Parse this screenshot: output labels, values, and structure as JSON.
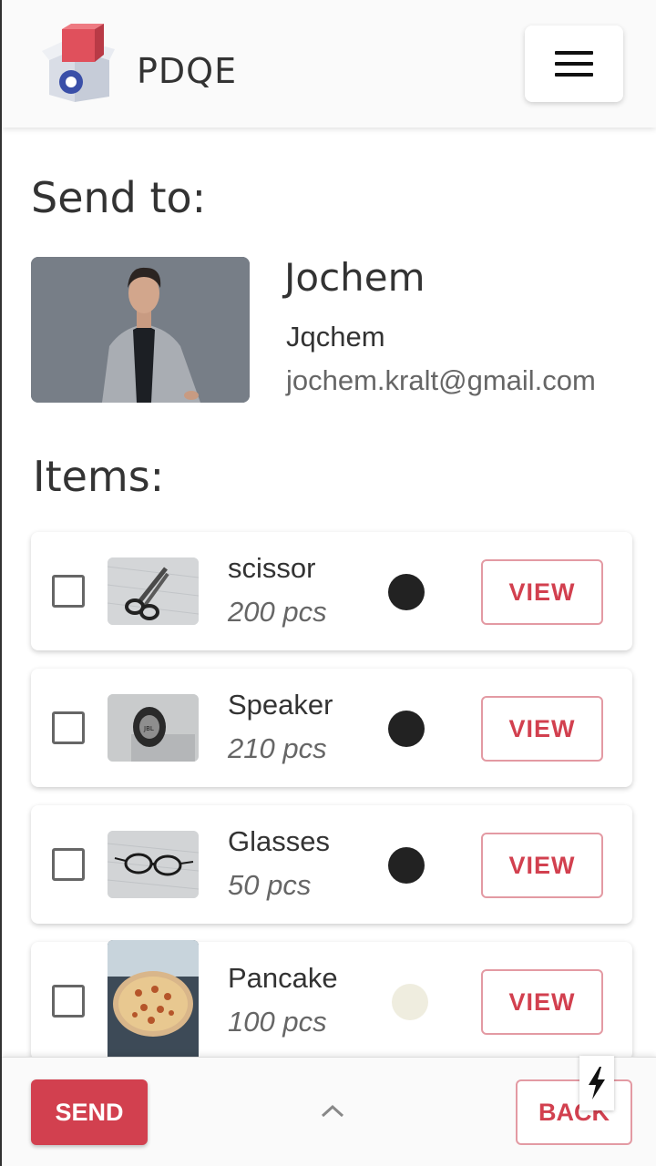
{
  "header": {
    "brand": "PDQE",
    "menu_icon": "hamburger-icon",
    "logo_icon": "box-logo-icon"
  },
  "send_to": {
    "title": "Send to:",
    "name": "Jochem",
    "username": "Jqchem",
    "email": "jochem.kralt@gmail.com"
  },
  "items_section": {
    "title": "Items:",
    "items": [
      {
        "name": "scissor",
        "qty": "200 pcs",
        "dot_color": "#222222",
        "view": "VIEW",
        "thumb": "scissor"
      },
      {
        "name": "Speaker",
        "qty": "210 pcs",
        "dot_color": "#222222",
        "view": "VIEW",
        "thumb": "speaker"
      },
      {
        "name": "Glasses",
        "qty": "50 pcs",
        "dot_color": "#222222",
        "view": "VIEW",
        "thumb": "glasses"
      },
      {
        "name": "Pancake",
        "qty": "100 pcs",
        "dot_color": "#efeddf",
        "view": "VIEW",
        "thumb": "pancake"
      }
    ]
  },
  "bottom_bar": {
    "send": "SEND",
    "back": "BACK",
    "chevron_icon": "chevron-up-icon",
    "bolt_icon": "lightning-bolt-icon"
  },
  "colors": {
    "accent": "#d2404f",
    "accent_border": "#e39aa3"
  }
}
